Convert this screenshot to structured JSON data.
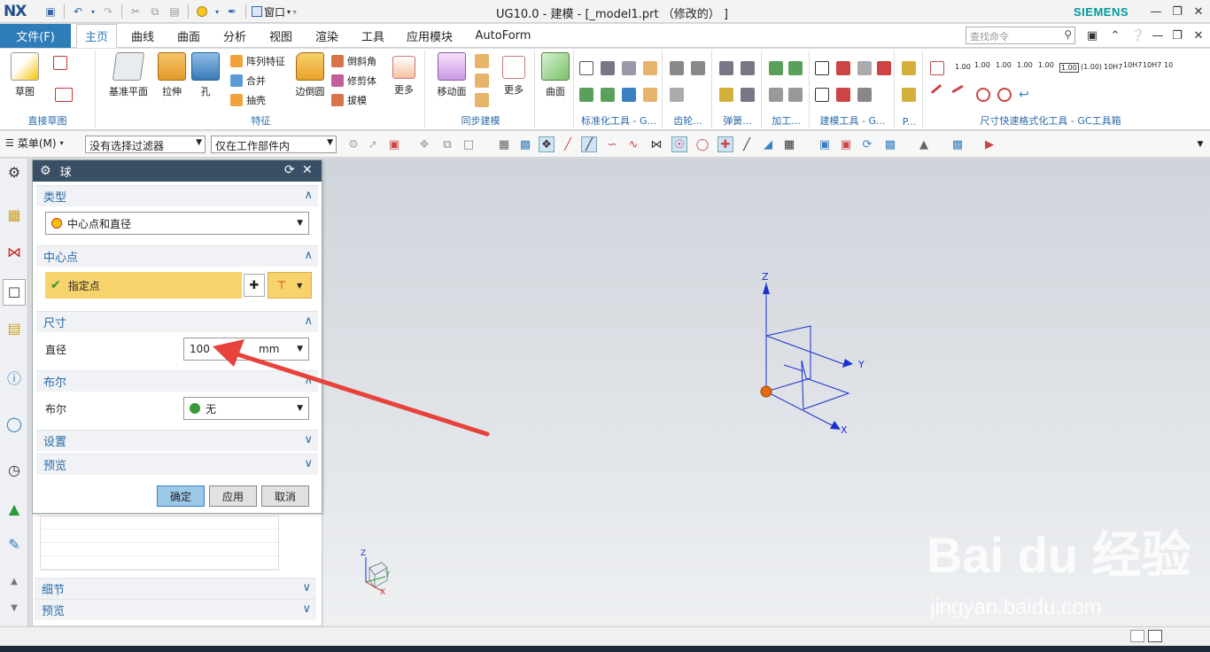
{
  "app": {
    "logo": "NX",
    "window_menu": "窗口",
    "title": "UG10.0 - 建模 - [_model1.prt （修改的） ]",
    "brand": "SIEMENS",
    "search_placeholder": "查找命令"
  },
  "tabs": [
    "文件(F)",
    "主页",
    "曲线",
    "曲面",
    "分析",
    "视图",
    "渲染",
    "工具",
    "应用模块",
    "AutoForm"
  ],
  "ribbon": {
    "sketch": "草图",
    "datum_plane": "基准平面",
    "extrude": "拉伸",
    "hole": "孔",
    "pattern_feature": "阵列特征",
    "unite": "合并",
    "shell": "抽壳",
    "edge_blend": "边倒圆",
    "chamfer": "倒斜角",
    "trim_body": "修剪体",
    "draft": "拔模",
    "more1": "更多",
    "move_face": "移动面",
    "more2": "更多",
    "surface": "曲面",
    "groups": [
      "直接草图",
      "特征",
      "同步建模",
      "标准化工具 - G...",
      "齿轮...",
      "弹簧...",
      "加工...",
      "建模工具 - G...",
      "P...",
      "尺寸快速格式化工具 - GC工具箱"
    ],
    "dim_labels": [
      "1.00",
      "1.00",
      "1.00",
      "1.00",
      "1.00",
      "1.00",
      "(1.00)",
      "10H7",
      "10H7",
      "10H7",
      "10"
    ]
  },
  "toolbar2": {
    "menu": "菜单(M)",
    "filter": "没有选择过滤器",
    "scope": "仅在工作部件内"
  },
  "dialog": {
    "title": "球",
    "type_header": "类型",
    "type_value": "中心点和直径",
    "center_header": "中心点",
    "specify_point": "指定点",
    "size_header": "尺寸",
    "diameter_label": "直径",
    "diameter_value": "100",
    "diameter_unit": "mm",
    "boolean_header": "布尔",
    "boolean_label": "布尔",
    "boolean_value": "无",
    "settings_header": "设置",
    "preview_header": "预览",
    "ok": "确定",
    "apply": "应用",
    "cancel": "取消"
  },
  "below_panel": {
    "detail": "细节",
    "preview": "预览"
  },
  "viewport": {
    "axes": {
      "x": "X",
      "y": "Y",
      "z": "Z"
    },
    "mini_axes": {
      "x": "X",
      "y": "Y",
      "z": "Z"
    }
  },
  "watermark": {
    "brand": "Bai du 经验",
    "url": "jingyan.baidu.com"
  },
  "colors": {
    "accent": "#2f7db8",
    "specify_point_bg": "#f8d36b",
    "axis_blue": "#1a2fd0",
    "annotation_arrow": "#e8423b",
    "point_orange": "#e06a10"
  }
}
